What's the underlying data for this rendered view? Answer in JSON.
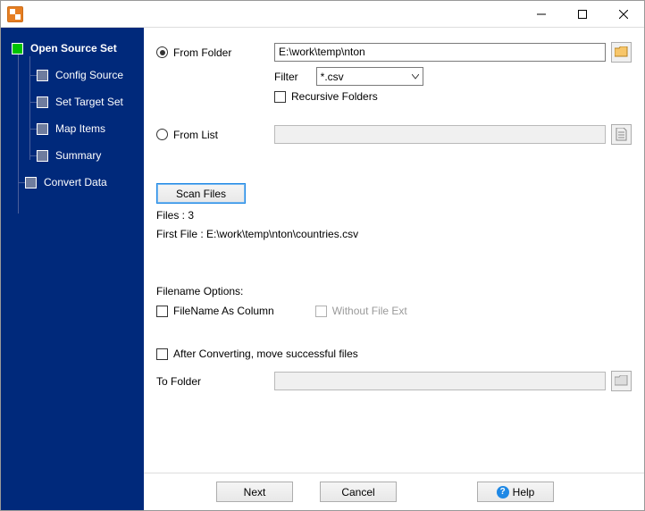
{
  "titlebar": {
    "title": ""
  },
  "sidebar": {
    "items": [
      {
        "label": "Open Source Set"
      },
      {
        "label": "Config Source"
      },
      {
        "label": "Set Target Set"
      },
      {
        "label": "Map Items"
      },
      {
        "label": "Summary"
      },
      {
        "label": "Convert Data"
      }
    ]
  },
  "source": {
    "from_folder_label": "From Folder",
    "folder_path": "E:\\work\\temp\\nton",
    "filter_label": "Filter",
    "filter_value": "*.csv",
    "recursive_label": "Recursive Folders",
    "from_list_label": "From List",
    "list_path": ""
  },
  "scan": {
    "button_label": "Scan Files",
    "files_count_label": "Files : 3",
    "first_file_label": "First File : E:\\work\\temp\\nton\\countries.csv"
  },
  "filename_options": {
    "heading": "Filename Options:",
    "as_column_label": "FileName As Column",
    "without_ext_label": "Without File Ext"
  },
  "after": {
    "move_label": "After Converting, move successful files",
    "to_folder_label": "To Folder",
    "to_folder_path": ""
  },
  "footer": {
    "next": "Next",
    "cancel": "Cancel",
    "help": "Help"
  }
}
